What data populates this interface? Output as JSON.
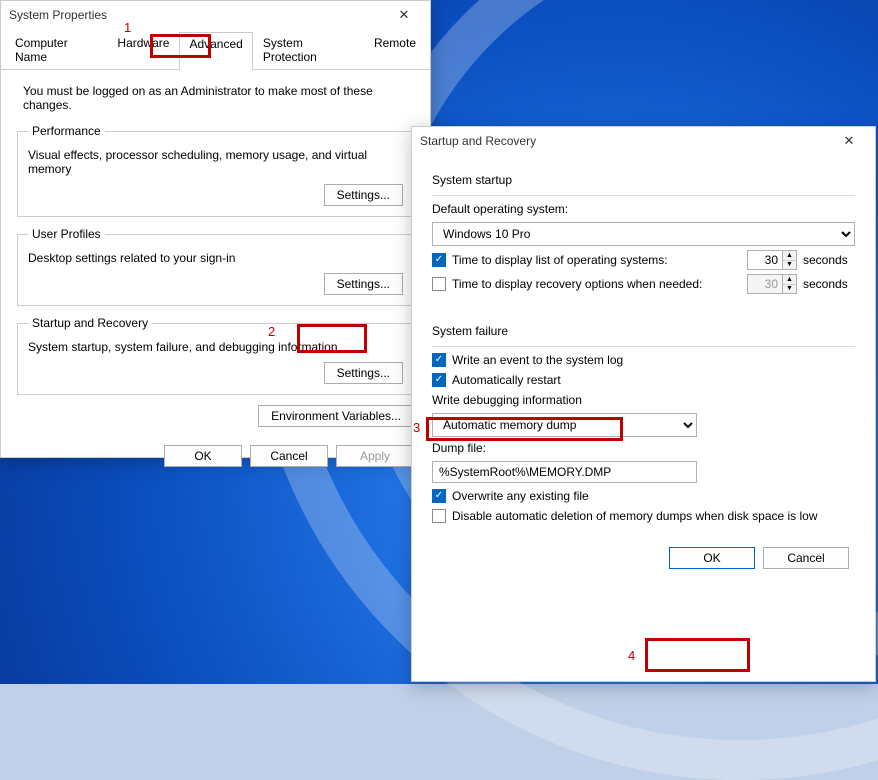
{
  "sysprop": {
    "title": "System Properties",
    "tabs": [
      "Computer Name",
      "Hardware",
      "Advanced",
      "System Protection",
      "Remote"
    ],
    "active_tab": "Advanced",
    "hint": "You must be logged on as an Administrator to make most of these changes.",
    "performance": {
      "legend": "Performance",
      "desc": "Visual effects, processor scheduling, memory usage, and virtual memory",
      "settings_btn": "Settings..."
    },
    "profiles": {
      "legend": "User Profiles",
      "desc": "Desktop settings related to your sign-in",
      "settings_btn": "Settings..."
    },
    "startup_group": {
      "legend": "Startup and Recovery",
      "desc": "System startup, system failure, and debugging information",
      "settings_btn": "Settings..."
    },
    "env_btn": "Environment Variables...",
    "ok": "OK",
    "cancel": "Cancel",
    "apply": "Apply"
  },
  "startup": {
    "title": "Startup and Recovery",
    "system_startup": {
      "heading": "System startup",
      "default_os_label": "Default operating system:",
      "default_os_value": "Windows 10 Pro",
      "display_list_label": "Time to display list of operating systems:",
      "display_list_checked": true,
      "display_list_value": "30",
      "display_recovery_label": "Time to display recovery options when needed:",
      "display_recovery_checked": false,
      "display_recovery_value": "30",
      "seconds": "seconds"
    },
    "system_failure": {
      "heading": "System failure",
      "write_event_label": "Write an event to the system log",
      "write_event_checked": true,
      "auto_restart_label": "Automatically restart",
      "auto_restart_checked": true,
      "dbg_label": "Write debugging information",
      "dbg_value": "Automatic memory dump",
      "dump_label": "Dump file:",
      "dump_value": "%SystemRoot%\\MEMORY.DMP",
      "overwrite_label": "Overwrite any existing file",
      "overwrite_checked": true,
      "disable_del_label": "Disable automatic deletion of memory dumps when disk space is low",
      "disable_del_checked": false
    },
    "ok": "OK",
    "cancel": "Cancel"
  },
  "callouts": {
    "c1": "1",
    "c2": "2",
    "c3": "3",
    "c4": "4"
  }
}
